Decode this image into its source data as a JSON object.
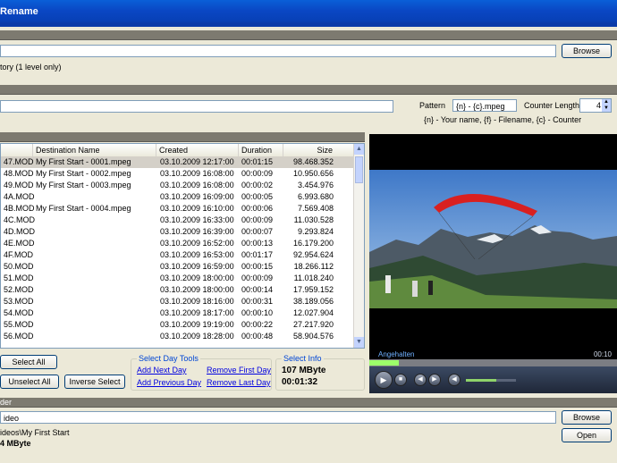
{
  "window": {
    "title": "Rename"
  },
  "source": {
    "path_value": "",
    "browse_label": "Browse",
    "option_text": "tory (1 level only)"
  },
  "naming": {
    "name_value": "",
    "pattern_label": "Pattern",
    "pattern_value": "{n} - {c}.mpeg",
    "counter_length_label": "Counter Length",
    "counter_length_value": "4",
    "hint": "{n} - Your name, {f} - Filename, {c} - Counter"
  },
  "list": {
    "columns": [
      "",
      "Destination Name",
      "Created",
      "Duration",
      "Size"
    ],
    "rows": [
      [
        "47.MOD",
        "My First Start - 0001.mpeg",
        "03.10.2009 12:17:00",
        "00:01:15",
        "98.468.352"
      ],
      [
        "48.MOD",
        "My First Start - 0002.mpeg",
        "03.10.2009 16:08:00",
        "00:00:09",
        "10.950.656"
      ],
      [
        "49.MOD",
        "My First Start - 0003.mpeg",
        "03.10.2009 16:08:00",
        "00:00:02",
        "3.454.976"
      ],
      [
        "4A.MOD",
        "",
        "03.10.2009 16:09:00",
        "00:00:05",
        "6.993.680"
      ],
      [
        "4B.MOD",
        "My First Start - 0004.mpeg",
        "03.10.2009 16:10:00",
        "00:00:06",
        "7.569.408"
      ],
      [
        "4C.MOD",
        "",
        "03.10.2009 16:33:00",
        "00:00:09",
        "11.030.528"
      ],
      [
        "4D.MOD",
        "",
        "03.10.2009 16:39:00",
        "00:00:07",
        "9.293.824"
      ],
      [
        "4E.MOD",
        "",
        "03.10.2009 16:52:00",
        "00:00:13",
        "16.179.200"
      ],
      [
        "4F.MOD",
        "",
        "03.10.2009 16:53:00",
        "00:01:17",
        "92.954.624"
      ],
      [
        "50.MOD",
        "",
        "03.10.2009 16:59:00",
        "00:00:15",
        "18.266.112"
      ],
      [
        "51.MOD",
        "",
        "03.10.2009 18:00:00",
        "00:00:09",
        "11.018.240"
      ],
      [
        "52.MOD",
        "",
        "03.10.2009 18:00:00",
        "00:00:14",
        "17.959.152"
      ],
      [
        "53.MOD",
        "",
        "03.10.2009 18:16:00",
        "00:00:31",
        "38.189.056"
      ],
      [
        "54.MOD",
        "",
        "03.10.2009 18:17:00",
        "00:00:10",
        "12.027.904"
      ],
      [
        "55.MOD",
        "",
        "03.10.2009 19:19:00",
        "00:00:22",
        "27.217.920"
      ],
      [
        "56.MOD",
        "",
        "03.10.2009 18:28:00",
        "00:00:48",
        "58.904.576"
      ]
    ]
  },
  "selection": {
    "select_all_label": "Select All",
    "unselect_all_label": "Unselect All",
    "inverse_select_label": "Inverse Select",
    "day_tools_title": "Select Day Tools",
    "add_next_day": "Add Next Day",
    "add_previous_day": "Add Previous Day",
    "remove_first_day": "Remove First Day",
    "remove_last_day": "Remove Last Day",
    "info_title": "Select Info",
    "info_size": "107 MByte",
    "info_duration": "00:01:32"
  },
  "player": {
    "status_text": "Angehalten",
    "time_text": "00:10",
    "progress_fraction": 0.12,
    "volume_fraction": 0.6
  },
  "destination": {
    "section_label": "der",
    "path_value": "ideo",
    "browse_label": "Browse",
    "open_label": "Open",
    "path_info": "ideos\\My First Start",
    "size_info": "4 MByte"
  },
  "colors": {
    "title_bar": "#0a47c4",
    "link": "#0000e0",
    "group_title": "#0046d5"
  }
}
